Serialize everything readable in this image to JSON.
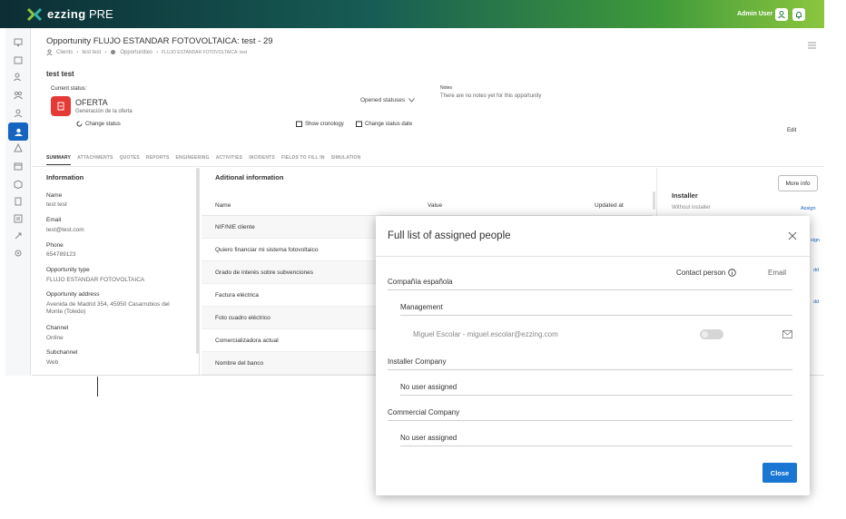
{
  "app": {
    "logo_text": "ezzing",
    "env": "PRE",
    "user": "Admin User",
    "brand_color": "#1a5c52",
    "accent": "#1976d2"
  },
  "page": {
    "title": "Opportunity FLUJO ESTANDAR FOTOVOLTAICA: test - 29",
    "breadcrumb": [
      "Clients",
      "test test",
      "Opportunities",
      "FLUJO ESTANDAR FOTOVOLTAICA: test"
    ],
    "name": "test test",
    "current_status_label": "Current status:",
    "status_name": "OFERTA",
    "status_desc": "Generación de la oferta",
    "change_status": "Change status",
    "opened_statuses": "Opened statuses",
    "show_cronology": "Show cronology",
    "change_status_date": "Change status date",
    "notes_label": "Notes",
    "notes_empty": "There are no notes yet for this opportunity",
    "edit": "Edit"
  },
  "tabs": [
    "SUMMARY",
    "ATTACHMENTS",
    "QUOTES",
    "REPORTS",
    "ENGINEERING",
    "ACTIVITIES",
    "INCIDENTS",
    "FIELDS TO FILL IN",
    "SIMULATION"
  ],
  "info": {
    "heading": "Information",
    "fields": [
      {
        "label": "Name",
        "value": "test test"
      },
      {
        "label": "Email",
        "value": "test@test.com"
      },
      {
        "label": "Phone",
        "value": "654789123"
      },
      {
        "label": "Opportunity type",
        "value": "FLUJO ESTANDAR FOTOVOLTAICA"
      },
      {
        "label": "Opportunity address",
        "value": "Avenida de Madrid 354, 45950 Casarrubios del Monte (Toledo)"
      },
      {
        "label": "Channel",
        "value": "Online"
      },
      {
        "label": "Subchannel",
        "value": "Web"
      }
    ]
  },
  "additional": {
    "heading": "Aditional information",
    "col_name": "Name",
    "col_value": "Value",
    "col_updated": "Updated at",
    "rows": [
      "NIF/NIE cliente",
      "Quiero financiar mi sistema fotovoltaico",
      "Grado de interés sobre subvenciones",
      "Factura eléctrica",
      "Foto cuadro eléctrico",
      "Comercializadora actual",
      "Nombre del banco"
    ]
  },
  "right_panel": {
    "more_info": "More info",
    "installer": "Installer",
    "without_installer": "Without installer",
    "assign": "Assign",
    "assign_short": "sign",
    "add_short": "dd"
  },
  "modal": {
    "title": "Full list of assigned people",
    "col_contact": "Contact person",
    "col_email": "Email",
    "group1": "Compañía española",
    "subgroup1": "Management",
    "person1": "Miguel Escolar - miguel.escolar@ezzing.com",
    "group2": "Installer Company",
    "group2_empty": "No user assigned",
    "group3": "Commercial Company",
    "group3_empty": "No user assigned",
    "close": "Close"
  }
}
